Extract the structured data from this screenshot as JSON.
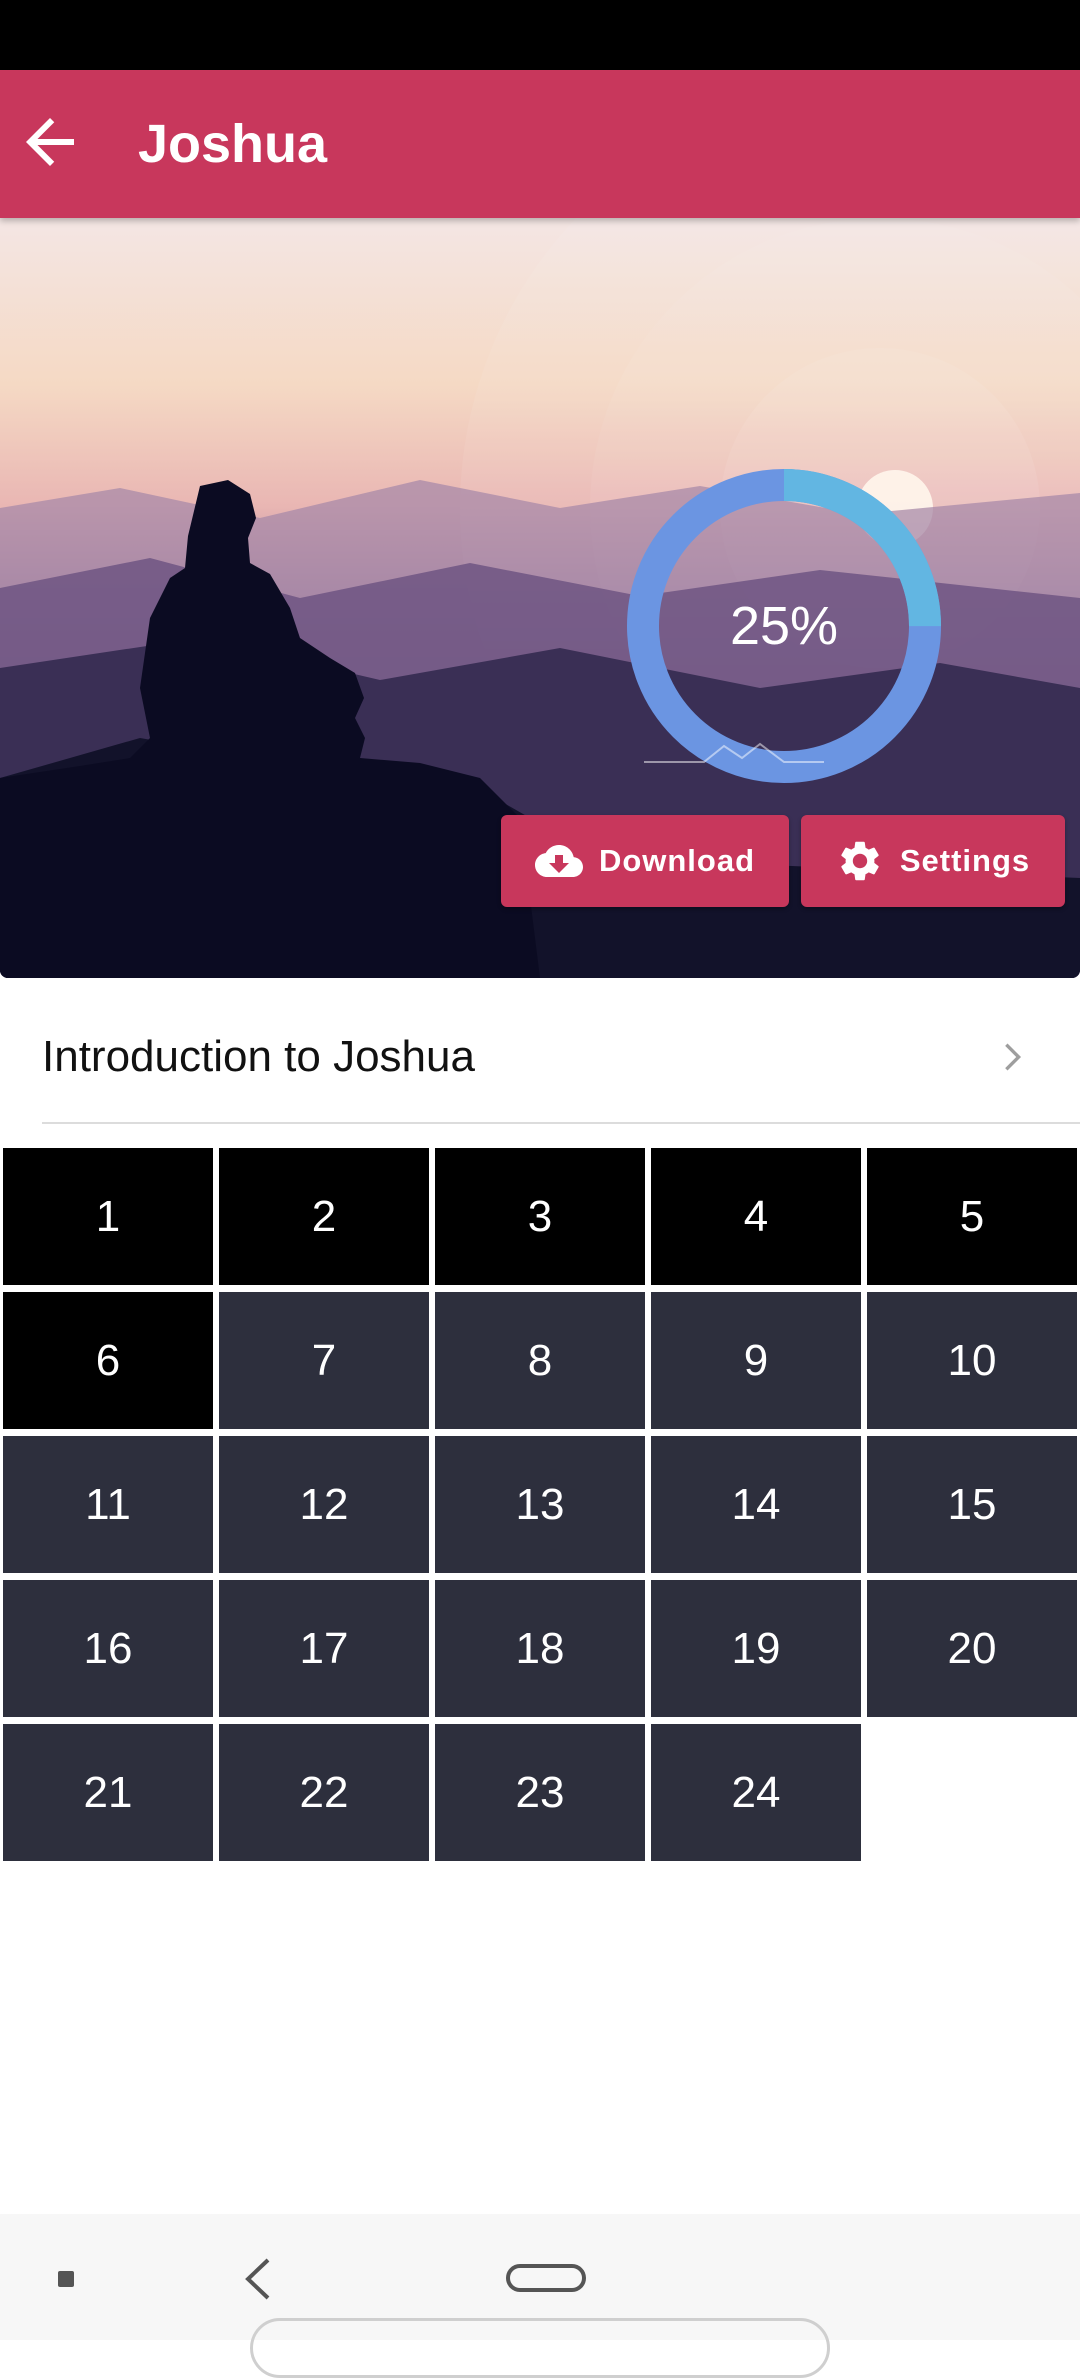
{
  "header": {
    "title": "Joshua",
    "back_icon": "arrow-left-icon"
  },
  "hero": {
    "progress": {
      "percent_label": "25%",
      "fraction": 0.25
    },
    "download_label": "Download",
    "settings_label": "Settings"
  },
  "intro": {
    "label": "Introduction to Joshua"
  },
  "chapters": [
    {
      "label": "1",
      "read": true
    },
    {
      "label": "2",
      "read": true
    },
    {
      "label": "3",
      "read": true
    },
    {
      "label": "4",
      "read": true
    },
    {
      "label": "5",
      "read": true
    },
    {
      "label": "6",
      "read": true
    },
    {
      "label": "7",
      "read": false
    },
    {
      "label": "8",
      "read": false
    },
    {
      "label": "9",
      "read": false
    },
    {
      "label": "10",
      "read": false
    },
    {
      "label": "11",
      "read": false
    },
    {
      "label": "12",
      "read": false
    },
    {
      "label": "13",
      "read": false
    },
    {
      "label": "14",
      "read": false
    },
    {
      "label": "15",
      "read": false
    },
    {
      "label": "16",
      "read": false
    },
    {
      "label": "17",
      "read": false
    },
    {
      "label": "18",
      "read": false
    },
    {
      "label": "19",
      "read": false
    },
    {
      "label": "20",
      "read": false
    },
    {
      "label": "21",
      "read": false
    },
    {
      "label": "22",
      "read": false
    },
    {
      "label": "23",
      "read": false
    },
    {
      "label": "24",
      "read": false
    }
  ],
  "colors": {
    "accent": "#c8375c",
    "read_cell": "#000000",
    "unread_cell": "#2d2f3d",
    "ring_track": "#6b95e2",
    "ring_progress": "#62b6e2"
  }
}
